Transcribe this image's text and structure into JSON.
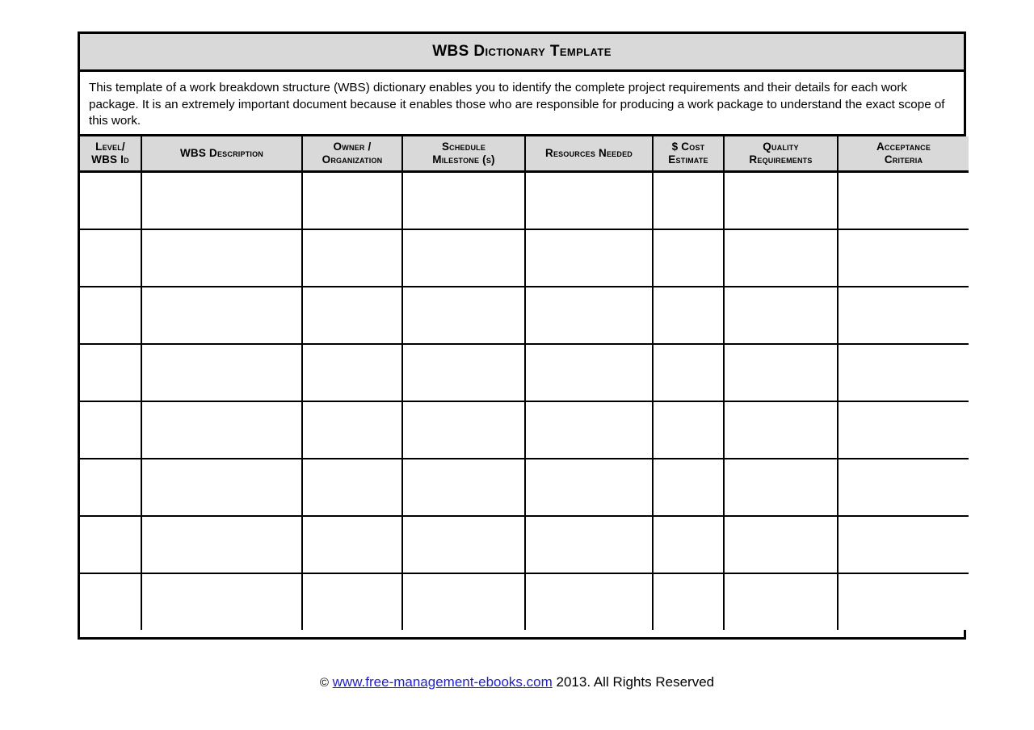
{
  "document": {
    "title_full": "WBS Dictionary Template",
    "title_acronym": "WBS",
    "title_rest": "Dictionary Template",
    "description": "This template of a work breakdown structure (WBS) dictionary enables you to identify the complete project requirements and their details for each work package. It is an extremely important document because it enables those who are responsible for producing a work package to understand the exact scope of this work."
  },
  "table": {
    "columns": [
      {
        "id": "level-wbs-id",
        "line1": "Level/",
        "line2": "WBS Id"
      },
      {
        "id": "wbs-description",
        "line1": "WBS Description",
        "line2": ""
      },
      {
        "id": "owner-organization",
        "line1": "Owner /",
        "line2": "Organization"
      },
      {
        "id": "schedule-milestones",
        "line1": "Schedule",
        "line2": "Milestone (s)"
      },
      {
        "id": "resources-needed",
        "line1": "Resources Needed",
        "line2": ""
      },
      {
        "id": "cost-estimate",
        "line1": "$ Cost",
        "line2": "Estimate"
      },
      {
        "id": "quality-requirements",
        "line1": "Quality",
        "line2": "Requirements"
      },
      {
        "id": "acceptance-criteria",
        "line1": "Acceptance",
        "line2": "Criteria"
      }
    ],
    "row_count": 8,
    "rows": [
      [
        "",
        "",
        "",
        "",
        "",
        "",
        "",
        ""
      ],
      [
        "",
        "",
        "",
        "",
        "",
        "",
        "",
        ""
      ],
      [
        "",
        "",
        "",
        "",
        "",
        "",
        "",
        ""
      ],
      [
        "",
        "",
        "",
        "",
        "",
        "",
        "",
        ""
      ],
      [
        "",
        "",
        "",
        "",
        "",
        "",
        "",
        ""
      ],
      [
        "",
        "",
        "",
        "",
        "",
        "",
        "",
        ""
      ],
      [
        "",
        "",
        "",
        "",
        "",
        "",
        "",
        ""
      ],
      [
        "",
        "",
        "",
        "",
        "",
        "",
        "",
        ""
      ]
    ]
  },
  "footer": {
    "copyright_symbol": "©",
    "site_url": "www.free-management-ebooks.com",
    "rights_text": "2013. All Rights Reserved"
  },
  "colors": {
    "header_fill": "#d9d9d9",
    "border": "#000000",
    "link": "#2222cc",
    "page_background": "#ffffff"
  }
}
